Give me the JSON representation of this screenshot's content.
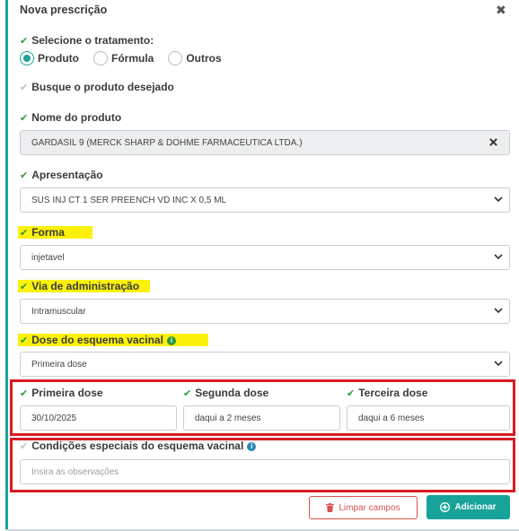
{
  "header": {
    "title": "Nova prescrição",
    "close_glyph": "✖"
  },
  "colors": {
    "accent": "#17a29a",
    "check": "#2e9a3a",
    "highlight": "#fbf10a",
    "annotation_red": "#d81b23",
    "danger": "#d9534f"
  },
  "treatment": {
    "label": "Selecione o tratamento:",
    "options": [
      {
        "label": "Produto",
        "selected": true
      },
      {
        "label": "Fórmula",
        "selected": false
      },
      {
        "label": "Outros",
        "selected": false
      }
    ]
  },
  "search": {
    "label": "Busque o produto desejado"
  },
  "product": {
    "label": "Nome do produto",
    "value": "GARDASIL 9 (MERCK SHARP & DOHME FARMACEUTICA LTDA.)",
    "clear_icon": "close-icon"
  },
  "presentation": {
    "label": "Apresentação",
    "value": "SUS INJ CT 1 SER PREENCH VD INC X 0,5 ML"
  },
  "forma": {
    "label": "Forma",
    "value": "injetavel"
  },
  "via": {
    "label": "Via de administração",
    "value": "Intramuscular"
  },
  "dose_scheme": {
    "label": "Dose do esquema vacinal",
    "value": "Primeira dose",
    "info_glyph": "i"
  },
  "doses": {
    "first": {
      "label": "Primeira dose",
      "value": "30/10/2025"
    },
    "second": {
      "label": "Segunda dose",
      "value": "daqui a 2 meses"
    },
    "third": {
      "label": "Terceira dose",
      "value": "daqui a 6 meses"
    }
  },
  "special": {
    "label": "Condições especiais do esquema vacinal",
    "placeholder": "Insira as observações",
    "info_glyph": "i"
  },
  "buttons": {
    "clear": "Limpar campos",
    "add": "Adicionar"
  },
  "glyphs": {
    "check": "✔"
  }
}
